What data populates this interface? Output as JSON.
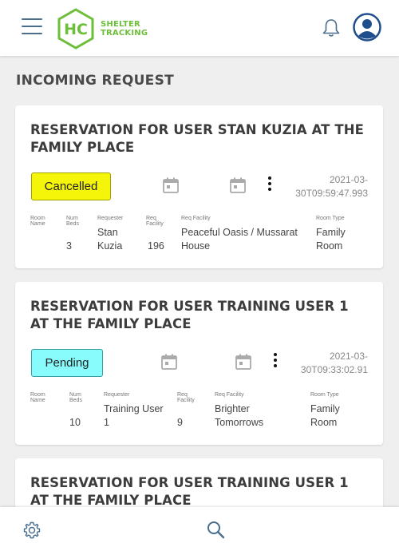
{
  "header": {
    "logo_mark": "HC",
    "logo_line1": "SHELTER",
    "logo_line2": "TRACKING",
    "menu_icon": "hamburger-menu-icon",
    "bell_icon": "bell-icon",
    "avatar_icon": "user-avatar-icon"
  },
  "page": {
    "title": "INCOMING REQUEST"
  },
  "columns": {
    "room_name": [
      "Room",
      "Name"
    ],
    "num_beds": [
      "Num",
      "Beds"
    ],
    "requester": "Requester",
    "req_facility_id": [
      "Req",
      "Facility"
    ],
    "req_facility": "Req Facility",
    "room_type": "Room Type"
  },
  "requests": [
    {
      "title": "RESERVATION FOR USER STAN KUZIA AT THE FAMILY PLACE",
      "status": "Cancelled",
      "timestamp": [
        "2021-03-",
        "30T09:59:47.993"
      ],
      "room_name": "",
      "num_beds": "3",
      "requester": [
        "Stan",
        "Kuzia"
      ],
      "req_facility_id": "196",
      "req_facility": [
        "Peaceful Oasis / Mussarat",
        "House"
      ],
      "room_type": [
        "Family",
        "Room"
      ]
    },
    {
      "title": "RESERVATION FOR USER TRAINING USER 1 AT THE FAMILY PLACE",
      "status": "Pending",
      "timestamp": [
        "2021-03-",
        "30T09:33:02.91"
      ],
      "room_name": "",
      "num_beds": "10",
      "requester": [
        "Training User",
        "1"
      ],
      "req_facility_id": "9",
      "req_facility": [
        "Brighter",
        "Tomorrows"
      ],
      "room_type": [
        "Family",
        "Room"
      ]
    },
    {
      "title": "RESERVATION FOR USER TRAINING USER 1 AT THE FAMILY PLACE"
    }
  ],
  "bottom_nav": {
    "settings_icon": "gear-icon",
    "search_icon": "search-icon"
  },
  "colors": {
    "brand_green": "#6dbf3a",
    "cancelled": "#f5f50a",
    "pending": "#88fbfc",
    "nav_icon": "#4a6d8c"
  }
}
